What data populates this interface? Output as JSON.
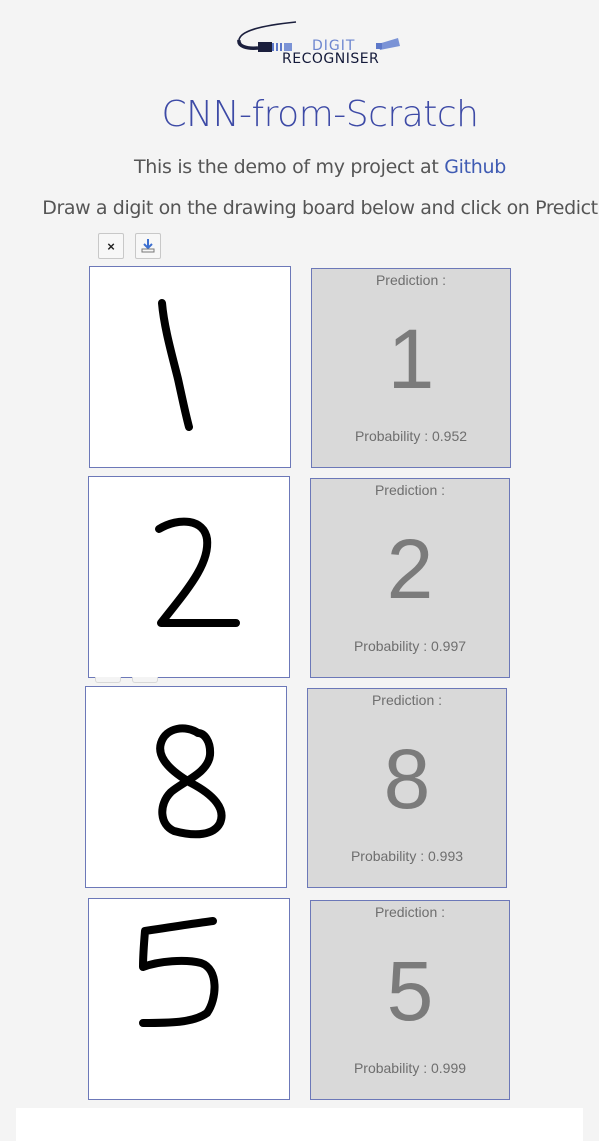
{
  "logo": {
    "line1": "DIGIT",
    "line2": "RECOGNISER"
  },
  "title": "CNN-from-Scratch",
  "subtitle": {
    "text": "This is the demo of my project at ",
    "link": "Github"
  },
  "instructions": "Draw a digit on the drawing board below and click on Predict",
  "toolbar": {
    "clear_label": "×",
    "clear_icon": "close-icon",
    "download_icon": "download-icon"
  },
  "predictions": [
    {
      "label": "Prediction :",
      "digit": "1",
      "prob": "Probability : 0.952"
    },
    {
      "label": "Prediction :",
      "digit": "2",
      "prob": "Probability : 0.997"
    },
    {
      "label": "Prediction :",
      "digit": "8",
      "prob": "Probability : 0.993"
    },
    {
      "label": "Prediction :",
      "digit": "5",
      "prob": "Probability : 0.999"
    }
  ],
  "colors": {
    "accent": "#3d4aa6",
    "border": "#6c78b8",
    "panel": "#d9d9d9"
  }
}
